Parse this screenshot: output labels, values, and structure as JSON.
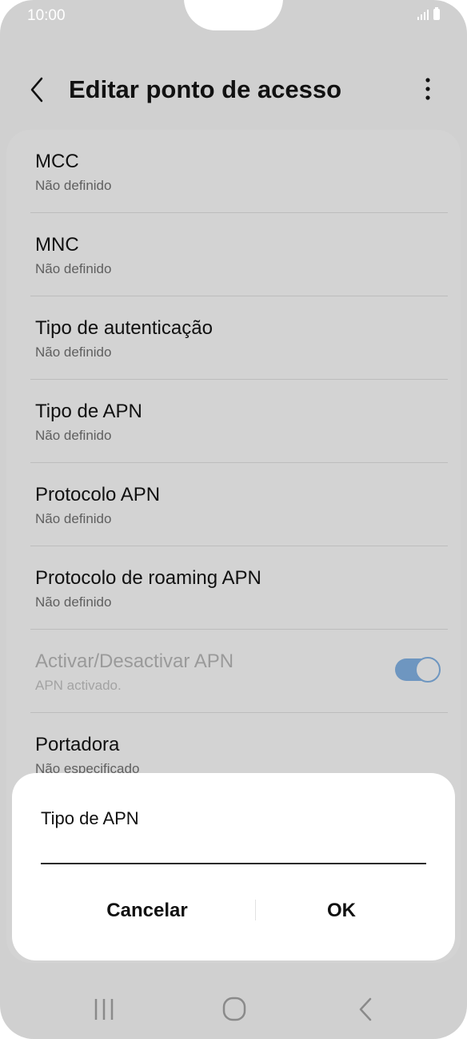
{
  "status_bar": {
    "time": "10:00",
    "icons": [
      "signal-icon",
      "battery-icon"
    ]
  },
  "header": {
    "title": "Editar ponto de acesso",
    "back_icon": "chevron-left-icon",
    "more_icon": "more-vertical-icon"
  },
  "settings": {
    "items": [
      {
        "title": "MCC",
        "subtitle": "Não definido"
      },
      {
        "title": "MNC",
        "subtitle": "Não definido"
      },
      {
        "title": "Tipo de autenticação",
        "subtitle": "Não definido"
      },
      {
        "title": "Tipo de APN",
        "subtitle": "Não definido"
      },
      {
        "title": "Protocolo APN",
        "subtitle": "Não definido"
      },
      {
        "title": "Protocolo de roaming APN",
        "subtitle": "Não definido"
      },
      {
        "title": "Activar/Desactivar APN",
        "subtitle": "APN activado.",
        "toggle_on": true,
        "disabled": true
      },
      {
        "title": "Portadora",
        "subtitle": "Não especificado"
      }
    ]
  },
  "dialog": {
    "title": "Tipo de APN",
    "input_value": "",
    "cancel_label": "Cancelar",
    "ok_label": "OK"
  },
  "nav": {
    "icons": [
      "recent-apps-icon",
      "home-icon",
      "back-icon"
    ]
  },
  "colors": {
    "toggle_accent": "#6e96c0",
    "dim_background": "#d0d0d0",
    "dialog_background": "#ffffff"
  }
}
